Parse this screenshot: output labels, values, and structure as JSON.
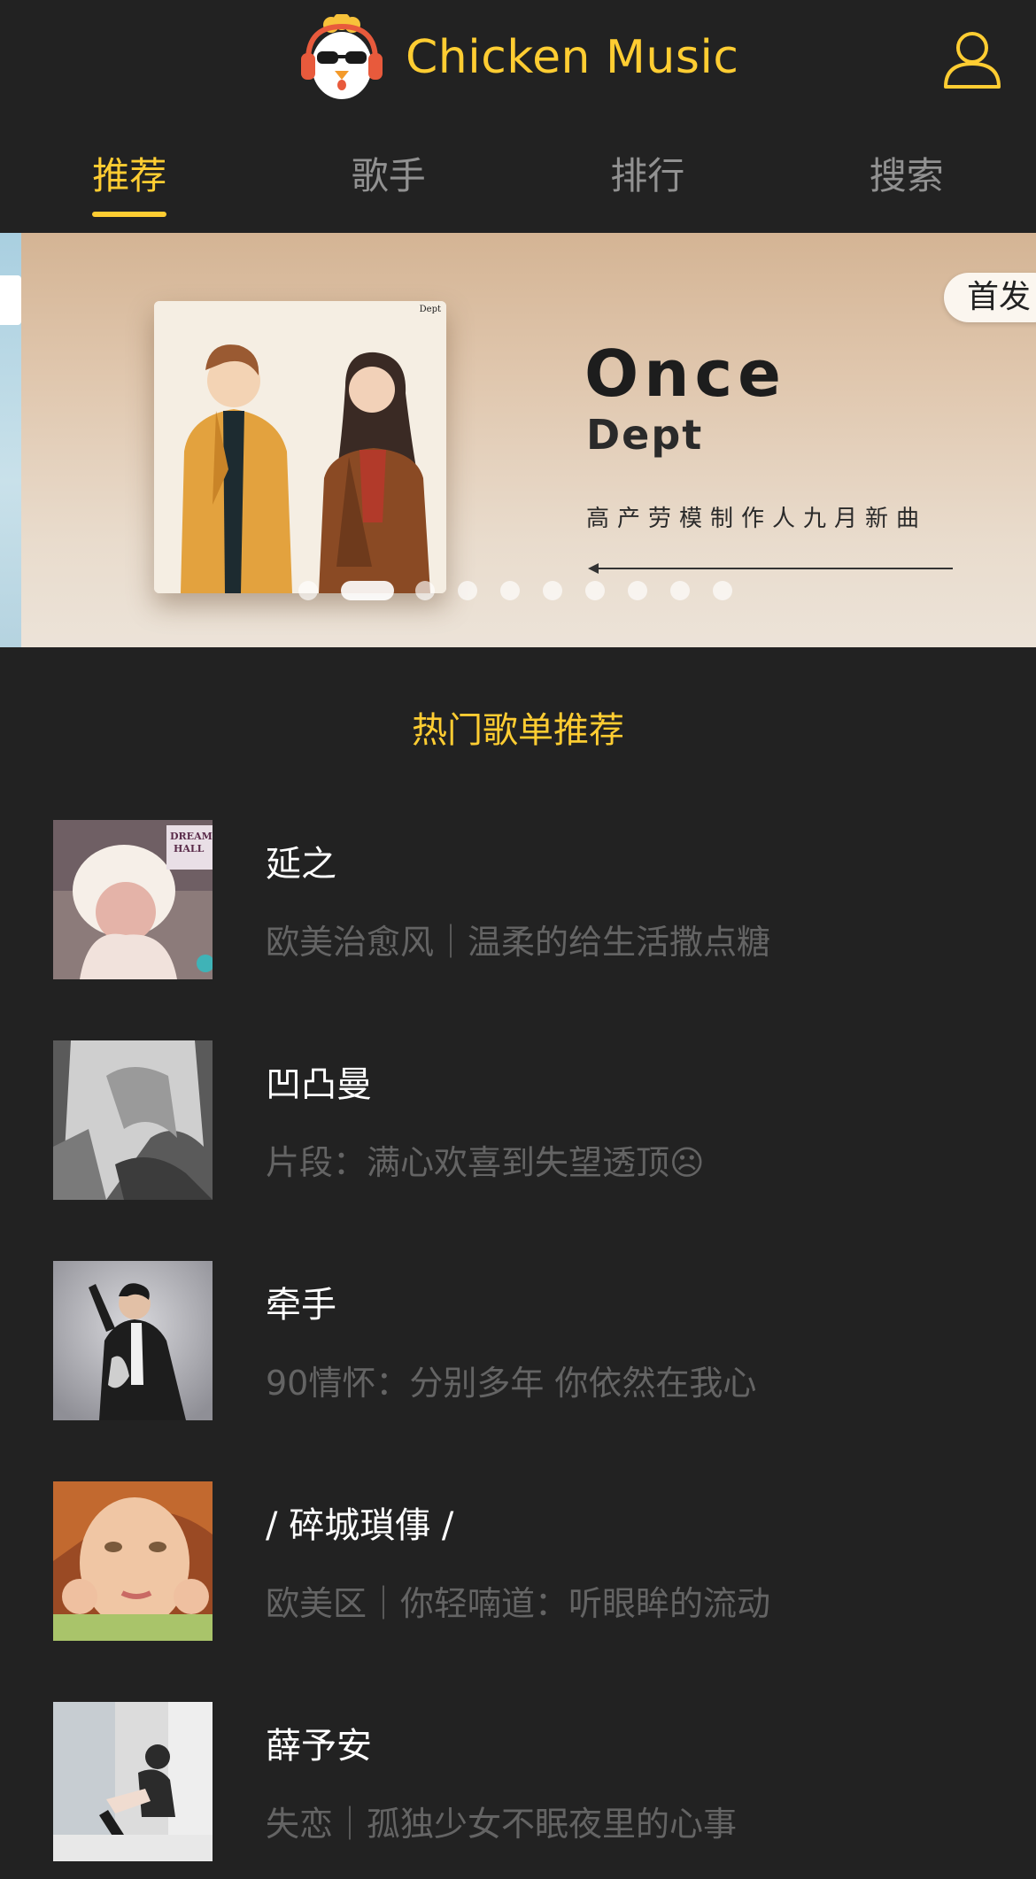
{
  "header": {
    "title": "Chicken Music",
    "logo_icon": "chicken-logo-icon",
    "user_icon": "user-icon",
    "accent": "#ffcd32",
    "background": "#222222"
  },
  "tabs": [
    {
      "label": "推荐",
      "active": true
    },
    {
      "label": "歌手",
      "active": false
    },
    {
      "label": "排行",
      "active": false
    },
    {
      "label": "搜索",
      "active": false
    }
  ],
  "slider": {
    "badge": "首发",
    "song_title": "Once",
    "artist": "Dept",
    "description": "高产劳模制作人九月新曲",
    "album_brand": "Dept",
    "dots_total": 10,
    "active_index": 1
  },
  "section": {
    "title": "热门歌单推荐"
  },
  "playlists": [
    {
      "name": "延之",
      "desc": "欧美治愈风｜温柔的给生活撒点糖"
    },
    {
      "name": "凹凸曼",
      "desc": "片段：满心欢喜到失望透顶☹"
    },
    {
      "name": "牵手",
      "desc": "90情怀：分别多年 你依然在我心"
    },
    {
      "name": "/ 碎城瑣倳 /",
      "desc": "欧美区｜你轻喃道：听眼眸的流动"
    },
    {
      "name": "薛予安",
      "desc": "失恋｜孤独少女不眠夜里的心事"
    }
  ]
}
